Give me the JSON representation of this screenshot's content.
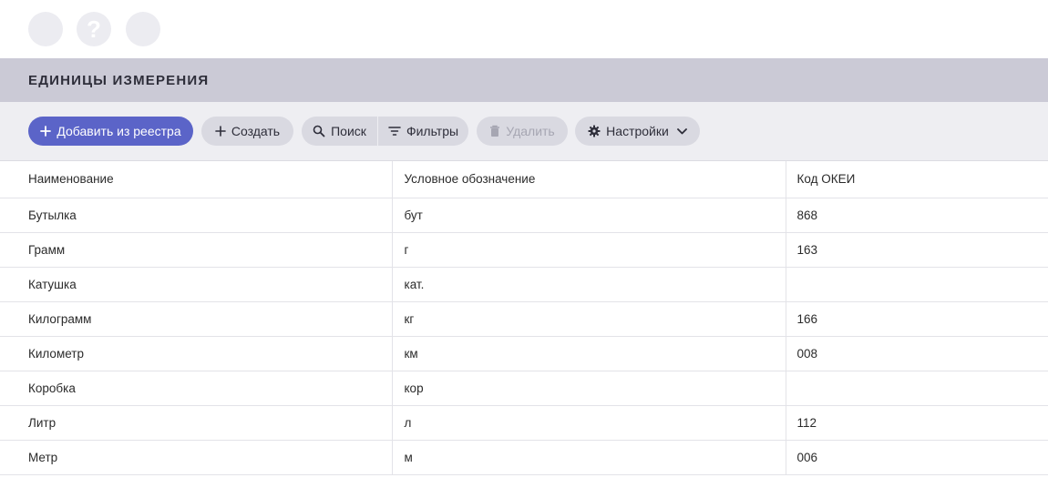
{
  "page": {
    "title": "ЕДИНИЦЫ ИЗМЕРЕНИЯ",
    "help_glyph": "?"
  },
  "toolbar": {
    "add_from_registry": "Добавить из реестра",
    "create": "Создать",
    "search": "Поиск",
    "filters": "Фильтры",
    "delete": "Удалить",
    "settings": "Настройки"
  },
  "table": {
    "columns": [
      "Наименование",
      "Условное обозначение",
      "Код ОКЕИ"
    ],
    "rows": [
      [
        "Бутылка",
        "бут",
        "868"
      ],
      [
        "Грамм",
        "г",
        "163"
      ],
      [
        "Катушка",
        "кат.",
        ""
      ],
      [
        "Килограмм",
        "кг",
        "166"
      ],
      [
        "Километр",
        "км",
        "008"
      ],
      [
        "Коробка",
        "кор",
        ""
      ],
      [
        "Литр",
        "л",
        "112"
      ],
      [
        "Метр",
        "м",
        "006"
      ]
    ]
  },
  "colors": {
    "primary": "#5b64c8",
    "title_bar": "#cbcad6",
    "toolbar_bg": "#eeeef2",
    "button_bg": "#d9d9e1"
  }
}
